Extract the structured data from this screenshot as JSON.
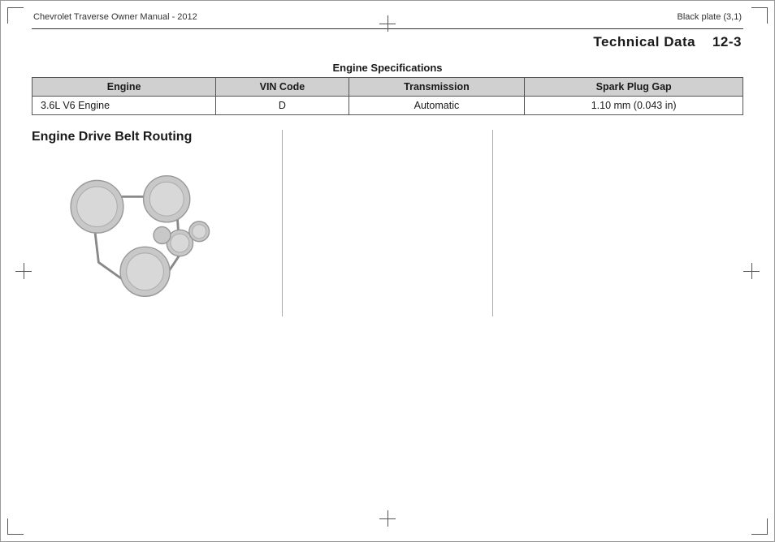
{
  "page": {
    "header_left": "Chevrolet Traverse Owner Manual - 2012",
    "header_right": "Black plate (3,1)",
    "title": "Technical Data",
    "page_number": "12-3"
  },
  "engine_specs": {
    "section_title": "Engine Specifications",
    "columns": [
      "Engine",
      "VIN Code",
      "Transmission",
      "Spark Plug Gap"
    ],
    "rows": [
      {
        "engine": "3.6L V6 Engine",
        "vin_code": "D",
        "transmission": "Automatic",
        "spark_plug_gap": "1.10 mm (0.043 in)"
      }
    ]
  },
  "belt_routing": {
    "title": "Engine Drive Belt Routing"
  }
}
